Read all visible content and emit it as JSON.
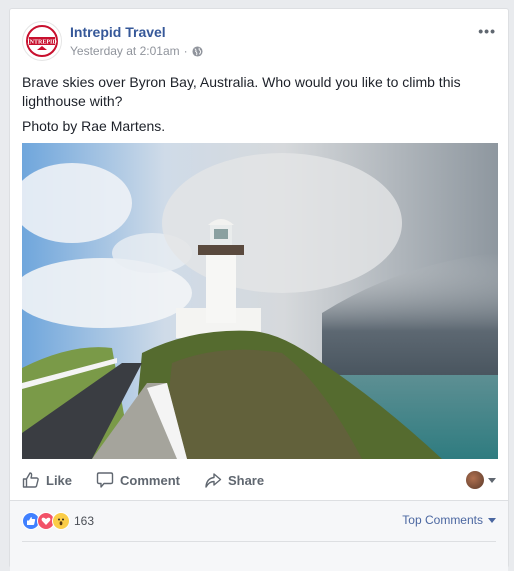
{
  "post": {
    "page_name": "Intrepid Travel",
    "timestamp": "Yesterday at 2:01am",
    "separator": "·",
    "privacy_icon": "globe-icon",
    "more_label": "•••",
    "text_lines": [
      "Brave skies over Byron Bay, Australia. Who would you like to climb this lighthouse with?",
      "Photo by Rae Martens."
    ],
    "photo_alt": "White lighthouse on a grassy headland under a stormy sky next to the sea"
  },
  "actions": {
    "like": "Like",
    "comment": "Comment",
    "share": "Share"
  },
  "footer": {
    "reactions": [
      "like",
      "love",
      "wow"
    ],
    "reaction_count": "163",
    "sort_label": "Top Comments"
  },
  "colors": {
    "link": "#365899",
    "like": "#4080ff",
    "love": "#f25268",
    "wow": "#fbcd48"
  }
}
